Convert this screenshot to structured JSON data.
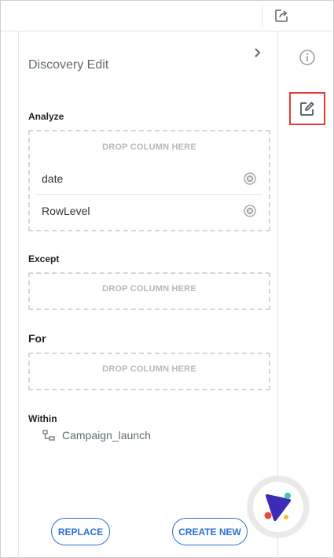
{
  "panel": {
    "title": "Discovery Edit"
  },
  "analyze": {
    "label": "Analyze",
    "drop_text": "DROP COLUMN HERE",
    "columns": [
      {
        "label": "date"
      },
      {
        "label": "RowLevel"
      }
    ]
  },
  "except": {
    "label": "Except",
    "drop_text": "DROP COLUMN HERE"
  },
  "for": {
    "label": "For",
    "drop_text": "DROP COLUMN HERE"
  },
  "within": {
    "label": "Within",
    "item": "Campaign_launch"
  },
  "actions": {
    "replace_label": "REPLACE",
    "create_new_label": "CREATE NEW"
  },
  "icons": {
    "share": "share-icon",
    "info": "info-icon",
    "edit": "edit-icon",
    "collapse": "chevron-right-icon",
    "remove": "remove-circle-icon",
    "hierarchy": "hierarchy-icon",
    "assistant": "assistant-logo-icon"
  },
  "colors": {
    "accent": "#2e6fd0",
    "highlight": "#e53935",
    "muted_text": "#5f6b72",
    "drop_text": "#b8b8b8"
  }
}
